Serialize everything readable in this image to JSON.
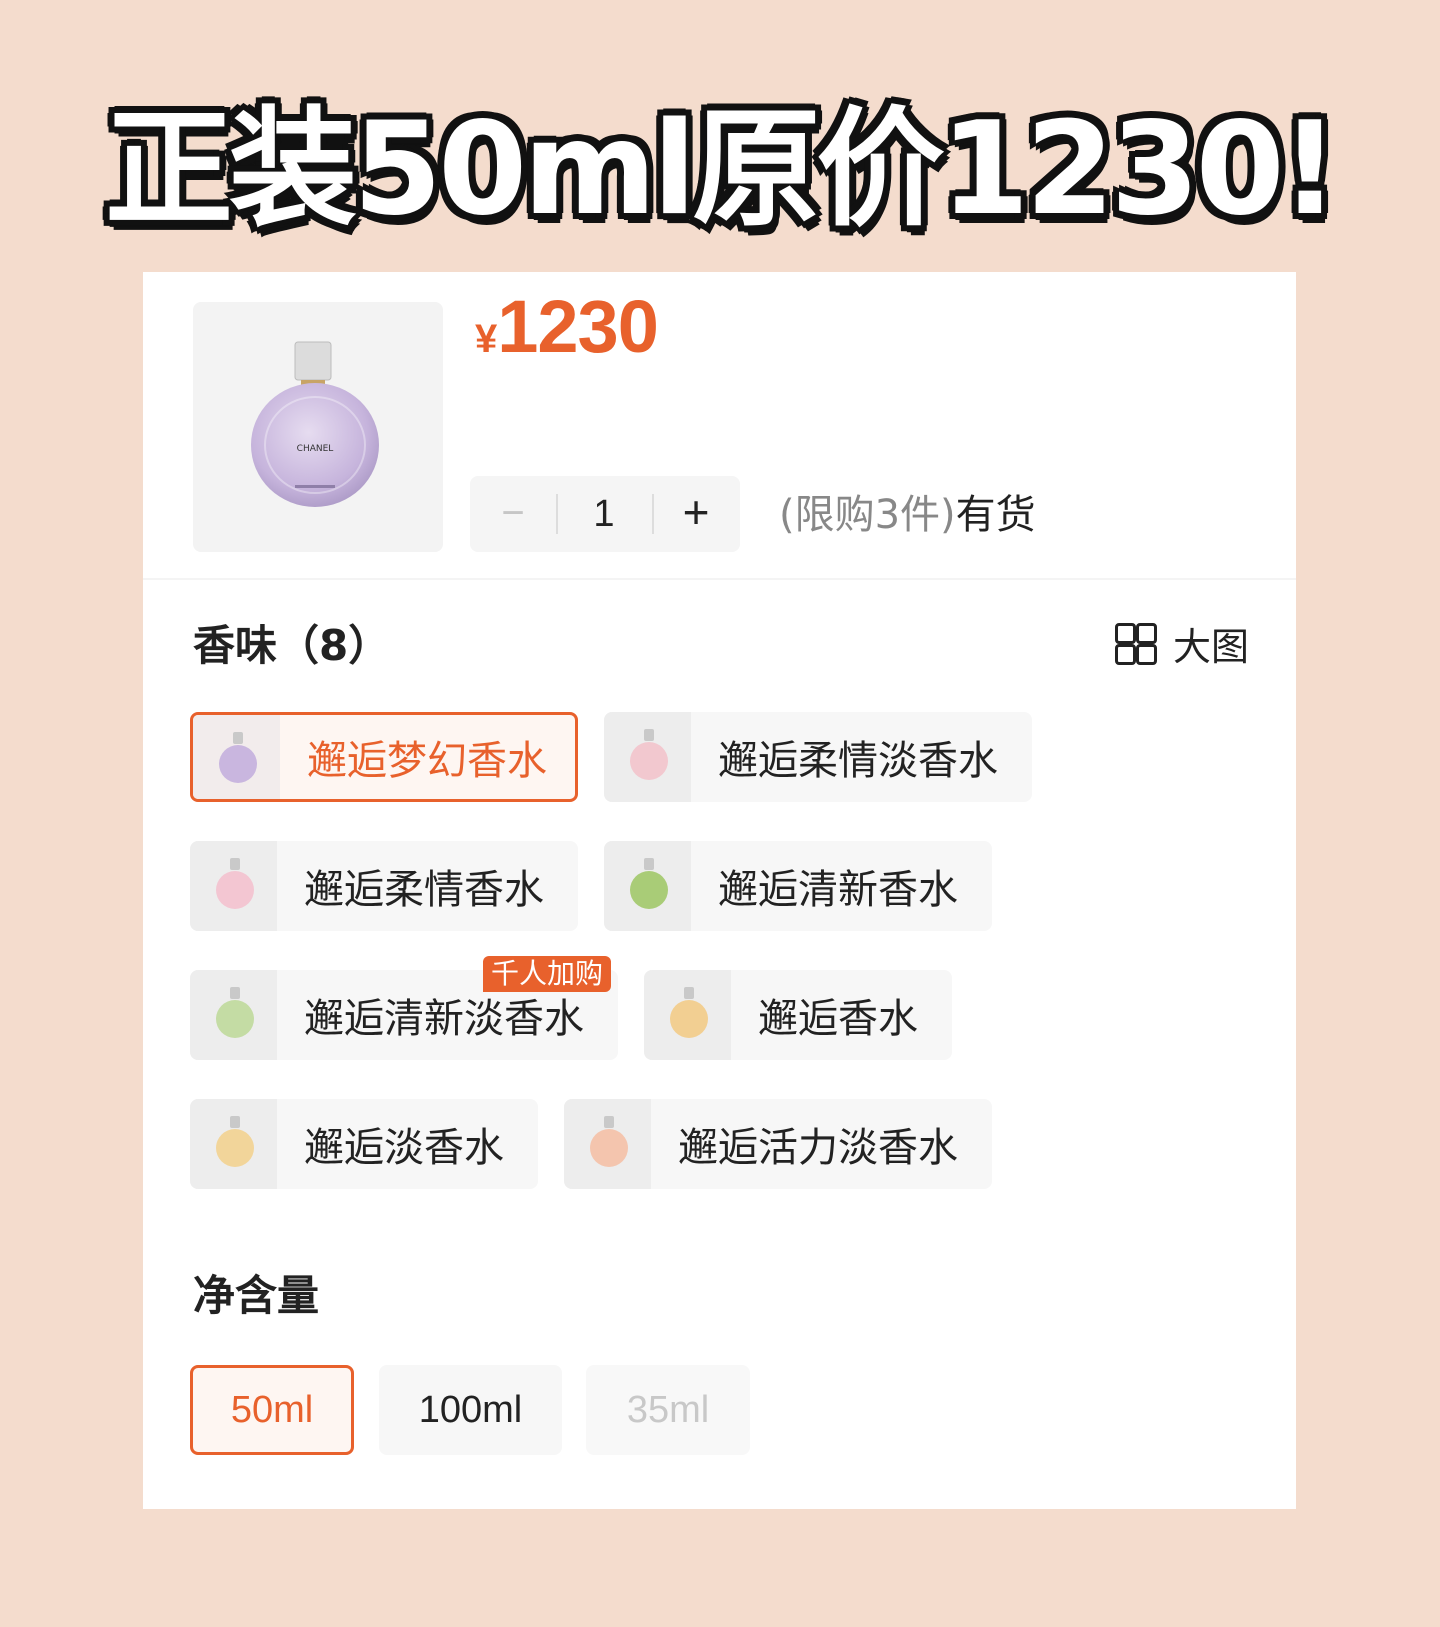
{
  "headline": "正装50ml原价1230!",
  "product": {
    "price_currency": "¥",
    "price_value": "1230",
    "bottle_label": "CHANEL",
    "quantity": "1",
    "minus_label": "−",
    "plus_label": "+",
    "limit_text": "(限购3件)",
    "stock_text": "有货"
  },
  "scent_section": {
    "title": "香味（8）",
    "bigview_label": "大图",
    "options": [
      {
        "label": "邂逅梦幻香水",
        "selected": true,
        "color": "#c9b6df"
      },
      {
        "label": "邂逅柔情淡香水",
        "selected": false,
        "color": "#f2c8cf"
      },
      {
        "label": "邂逅柔情香水",
        "selected": false,
        "color": "#f3c6d2"
      },
      {
        "label": "邂逅清新香水",
        "selected": false,
        "color": "#a9cc77"
      },
      {
        "label": "邂逅清新淡香水",
        "selected": false,
        "color": "#c4dca4",
        "badge": "千人加购"
      },
      {
        "label": "邂逅香水",
        "selected": false,
        "color": "#f2cf92"
      },
      {
        "label": "邂逅淡香水",
        "selected": false,
        "color": "#f2d59a"
      },
      {
        "label": "邂逅活力淡香水",
        "selected": false,
        "color": "#f4c5ae"
      }
    ]
  },
  "volume_section": {
    "title": "净含量",
    "options": [
      {
        "label": "50ml",
        "state": "selected"
      },
      {
        "label": "100ml",
        "state": "available"
      },
      {
        "label": "35ml",
        "state": "disabled"
      }
    ]
  },
  "colors": {
    "accent": "#e8612c",
    "background": "#f4dccd"
  }
}
